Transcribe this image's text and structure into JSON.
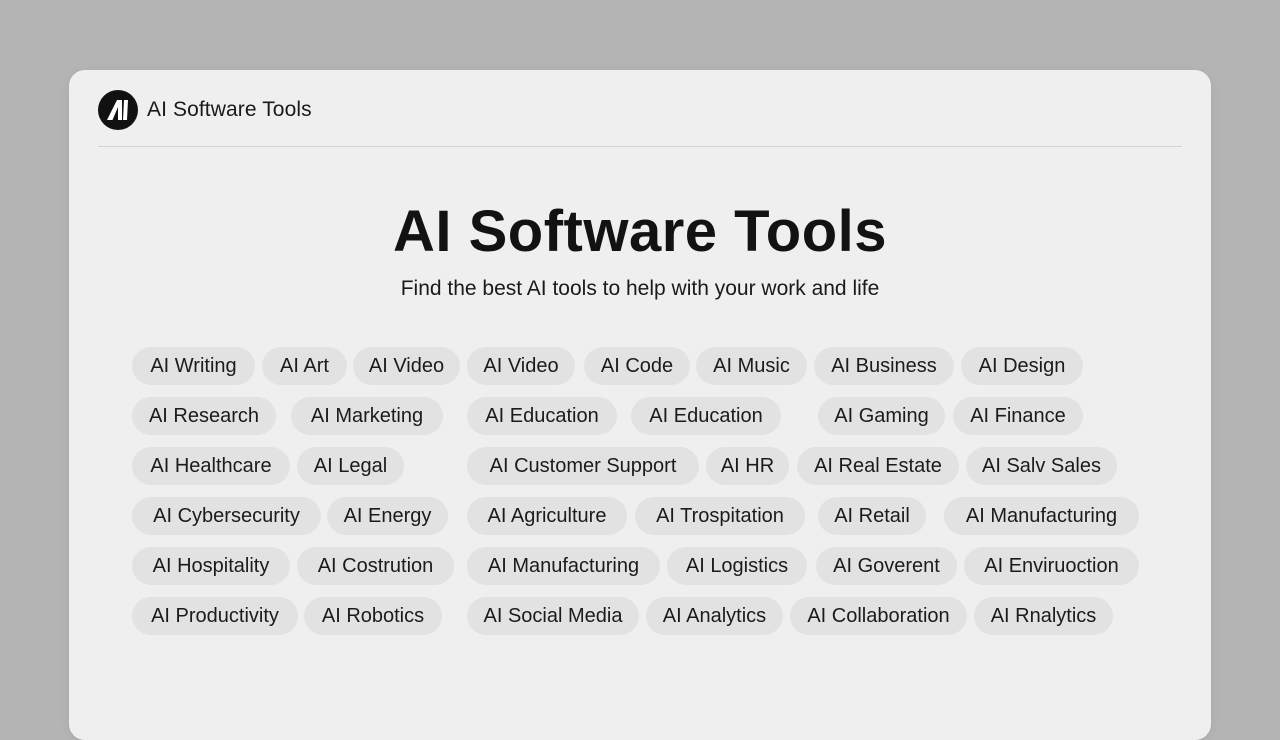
{
  "header": {
    "brand": "AI Software Tools",
    "logo_icon": "ai-logo-icon"
  },
  "hero": {
    "title": "AI Software Tools",
    "subtitle": "Find the best AI tools to help with your work and life"
  },
  "categories": [
    [
      "AI Writing",
      "AI Art",
      "AI Video",
      "AI Video",
      "AI Code",
      "AI Music",
      "AI Business",
      "AI Design"
    ],
    [
      "AI Research",
      "AI Marketing",
      "AI Education",
      "AI Education",
      "AI Gaming",
      "AI Finance"
    ],
    [
      "AI Healthcare",
      "AI Legal",
      "AI Customer Support",
      "AI HR",
      "AI Real Estate",
      "AI Salv Sales"
    ],
    [
      "AI Cybersecurity",
      "AI Energy",
      "AI Agriculture",
      "AI Trospitation",
      "AI Retail",
      "AI Manufacturing"
    ],
    [
      "AI Hospitality",
      "AI Costrution",
      "AI Manufacturing",
      "AI Logistics",
      "AI Goverent",
      "AI Enviruoction"
    ],
    [
      "AI Productivity",
      "AI Robotics",
      "AI Social Media",
      "AI Analytics",
      "AI Collaboration",
      "AI Rnalytics"
    ]
  ],
  "colors": {
    "page_bg": "#b3b4b3",
    "card_bg": "#efefef",
    "chip_bg": "#e2e2e2",
    "text": "#141414"
  }
}
